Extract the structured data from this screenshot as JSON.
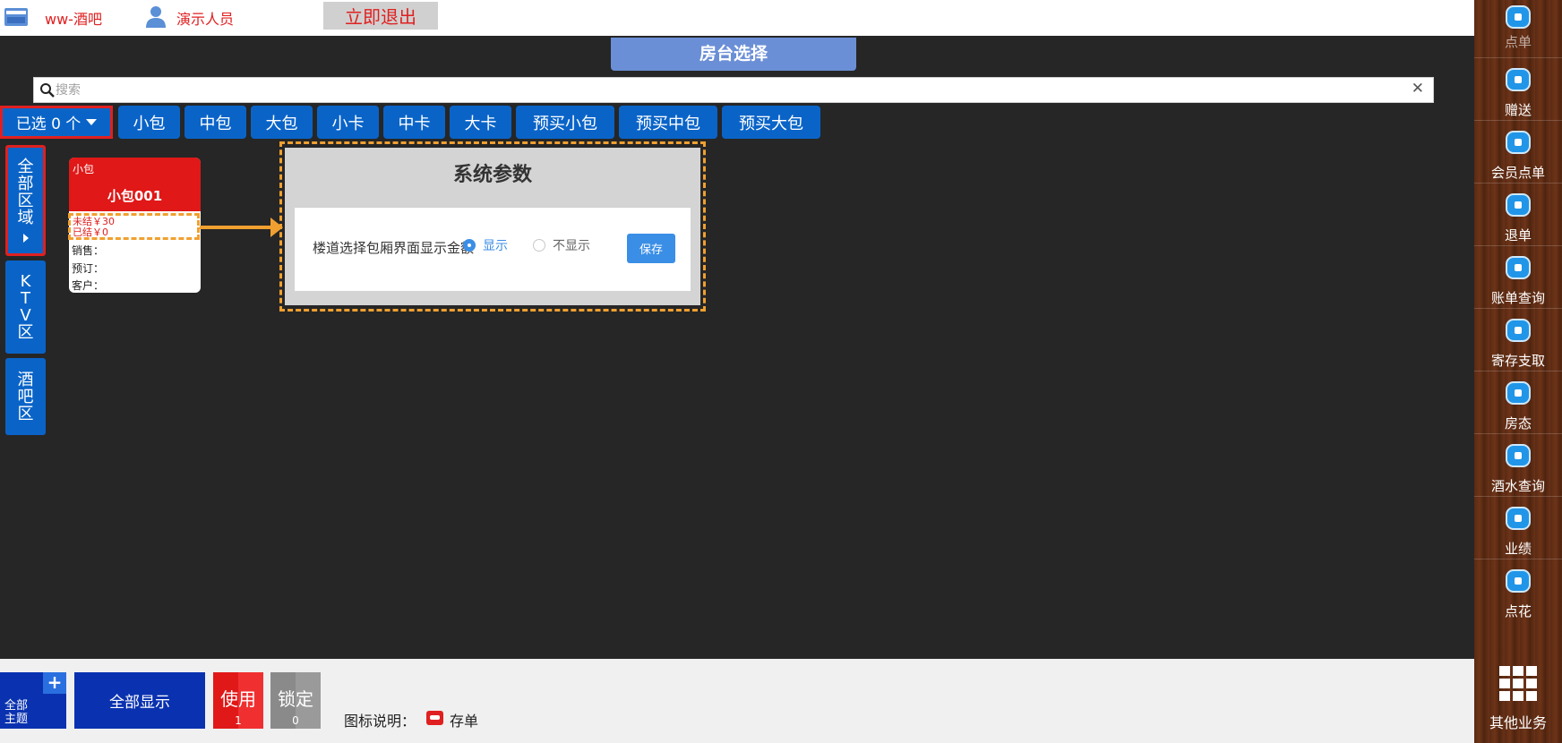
{
  "header": {
    "store_name": "ww-酒吧",
    "user_name": "演示人员",
    "exit_label": "立即退出"
  },
  "title": "房台选择",
  "search": {
    "placeholder": "搜索"
  },
  "filter": {
    "selected_label": "已选 0 个",
    "types": [
      "小包",
      "中包",
      "大包",
      "小卡",
      "中卡",
      "大卡",
      "预买小包",
      "预买中包",
      "预买大包"
    ]
  },
  "areas": [
    {
      "chars": [
        "全",
        "部",
        "区",
        "域"
      ]
    },
    {
      "chars": [
        "K",
        "T",
        "V",
        "区"
      ]
    },
    {
      "chars": [
        "酒",
        "吧",
        "区"
      ]
    }
  ],
  "room": {
    "type": "小包",
    "name": "小包001",
    "unsettled": "未结￥30",
    "settled": "已结￥0",
    "sales": "销售：",
    "reserve": "预订：",
    "customer": "客户："
  },
  "dialog": {
    "title": "系统参数",
    "param_label": "楼道选择包厢界面显示金额",
    "option_show": "显示",
    "option_hide": "不显示",
    "save_label": "保存"
  },
  "sidebar": {
    "items": [
      "点单",
      "赠送",
      "会员点单",
      "退单",
      "账单查询",
      "寄存支取",
      "房态",
      "酒水查询",
      "业绩",
      "点花"
    ],
    "other": "其他业务"
  },
  "bottom": {
    "theme_label_1": "全部",
    "theme_label_2": "主题",
    "show_all": "全部显示",
    "use_label": "使用",
    "use_count": "1",
    "lock_label": "锁定",
    "lock_count": "0",
    "legend_label": "图标说明：",
    "store_label": "存单"
  },
  "colors": {
    "primary_blue": "#0a64c8",
    "alert_red": "#e02020",
    "highlight_orange": "#f0a030",
    "title_blue": "#6b8fd6"
  }
}
